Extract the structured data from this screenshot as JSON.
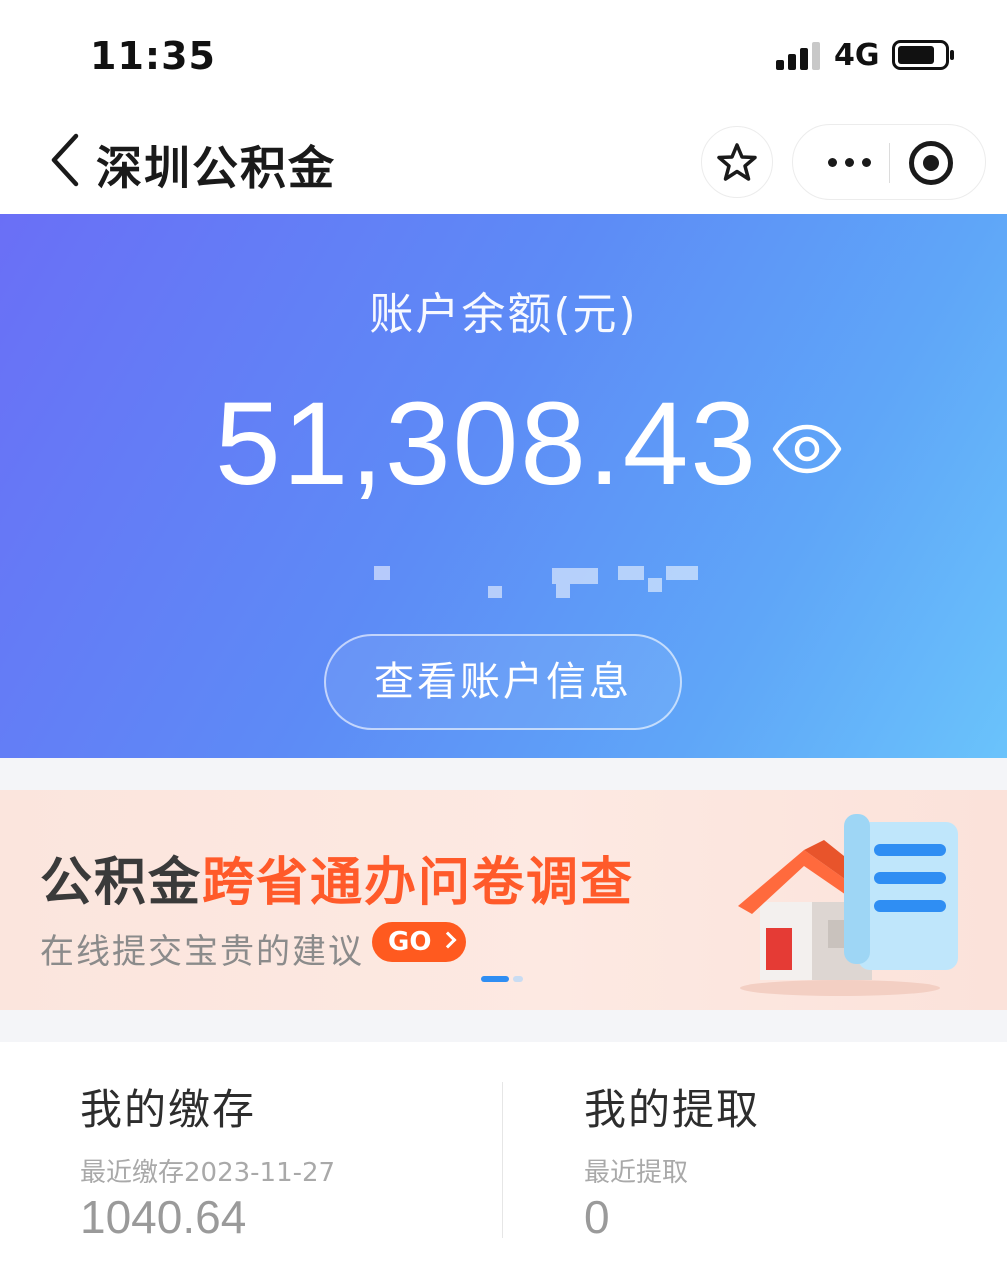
{
  "status_bar": {
    "time": "11:35",
    "network": "4G",
    "icons": [
      "signal-icon",
      "battery-icon"
    ]
  },
  "nav": {
    "title": "深圳公积金",
    "icons": [
      "back-icon",
      "star-icon",
      "more-icon",
      "target-icon"
    ]
  },
  "account": {
    "label": "账户余额(元)",
    "balance": "51,308.43",
    "view_button": "查看账户信息",
    "colors": {
      "gradient_start": "#6a6ff6",
      "gradient_end": "#6ac3fb"
    }
  },
  "banner": {
    "title_dark": "公积金",
    "title_accent": "跨省通办问卷调查",
    "subtitle": "在线提交宝贵的建议",
    "go_label": "GO",
    "accent_color": "#ff5a2a",
    "page_indicator": {
      "active": 1,
      "total": 2
    }
  },
  "deposit": {
    "title": "我的缴存",
    "meta": "最近缴存2023-11-27",
    "value": "1040.64"
  },
  "withdrawal": {
    "title": "我的提取",
    "meta": "最近提取",
    "value": "0"
  }
}
